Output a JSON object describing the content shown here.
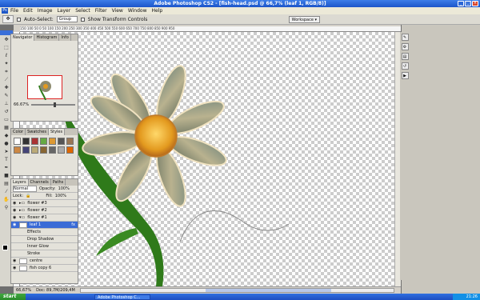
{
  "window": {
    "title": "Adobe Photoshop CS2 - [fish-head.psd @ 66,7% (leaf 1, RGB/8)]"
  },
  "menu": [
    "File",
    "Edit",
    "Image",
    "Layer",
    "Select",
    "Filter",
    "View",
    "Window",
    "Help"
  ],
  "options": {
    "auto_select_label": "Auto-Select:",
    "auto_select_value": "Group",
    "transform_label": "Show Transform Controls",
    "workspace_label": "Workspace ▾"
  },
  "ruler": {
    "ticks": "150   100   50   0   50   100   150   200   250   300   350   400   450   500   550   600   650   700   750   800   850   900   950"
  },
  "status": {
    "zoom": "66,67%",
    "doc": "Doc: 89,7M/209,4M"
  },
  "panels": {
    "navigator_tabs": [
      "Navigator",
      "Histogram",
      "Info"
    ],
    "navigator_zoom": "66.67%",
    "color_tabs": [
      "Color",
      "Swatches",
      "Styles"
    ],
    "layers_tabs": [
      "Layers",
      "Channels",
      "Paths"
    ],
    "blend_mode": "Normal",
    "opacity_label": "Opacity:",
    "opacity_value": "100%",
    "lock_label": "Lock:",
    "fill_label": "Fill:",
    "fill_value": "100%",
    "layers": [
      {
        "name": "flower #3"
      },
      {
        "name": "flower #2"
      },
      {
        "name": "flower #1"
      },
      {
        "name": "leaf 1"
      }
    ],
    "effects": [
      "Effects",
      "Drop Shadow",
      "Inner Glow",
      "Stroke"
    ],
    "layers_bottom": [
      {
        "name": "centre"
      },
      {
        "name": "fish copy 6"
      }
    ]
  },
  "taskbar": {
    "start": "start",
    "task": "Adobe Photoshop C...",
    "clock": "21:26"
  },
  "colors": {
    "accent": "#1d55c9",
    "leaf": "#2f7a1a",
    "center": "#e39a1f"
  }
}
